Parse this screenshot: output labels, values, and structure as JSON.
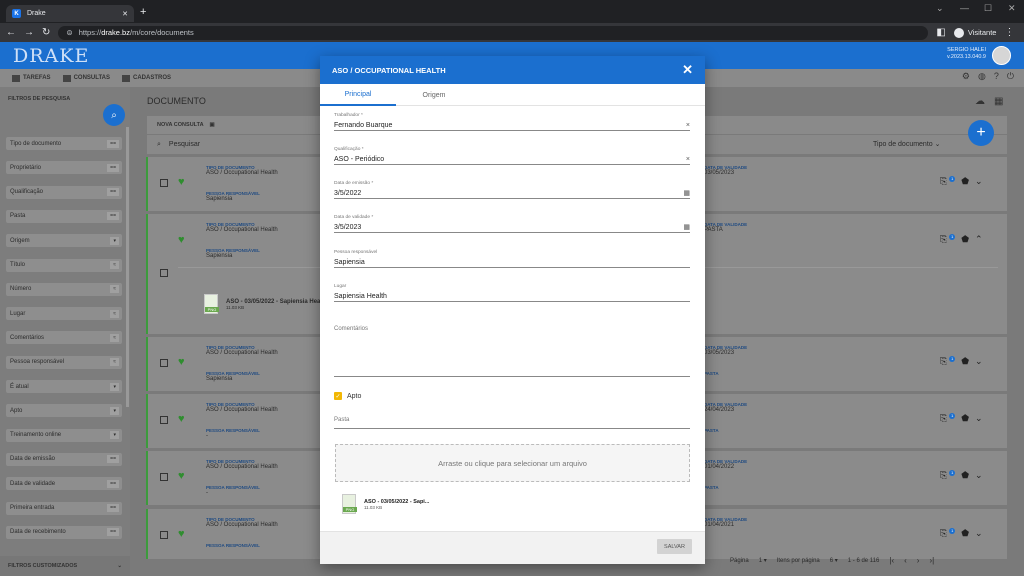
{
  "browser": {
    "tab_title": "Drake",
    "url_prefix": "https://",
    "url_host": "drake.bz",
    "url_path": "/m/core/documents",
    "profile": "Visitante"
  },
  "app": {
    "logo": "DRAKE",
    "user_name": "SERGIO HALEI",
    "user_version": "v.2023.13.040.9",
    "accent": "#1b6fcf"
  },
  "nav": {
    "items": [
      "TAREFAS",
      "CONSULTAS",
      "CADASTROS"
    ]
  },
  "sidebar": {
    "title": "FILTROS DE PESQUISA",
    "footer": "FILTROS CUSTOMIZADOS",
    "filters": [
      {
        "label": "Tipo de documento",
        "op": "=="
      },
      {
        "label": "Proprietário",
        "op": "=="
      },
      {
        "label": "Qualificação",
        "op": "=="
      },
      {
        "label": "Pasta",
        "op": "=="
      },
      {
        "label": "Origem",
        "op": "▾"
      },
      {
        "label": "Título",
        "op": "≈"
      },
      {
        "label": "Número",
        "op": "≈"
      },
      {
        "label": "Lugar",
        "op": "≈"
      },
      {
        "label": "Comentários",
        "op": "≈"
      },
      {
        "label": "Pessoa responsável",
        "op": "≈"
      },
      {
        "label": "É atual",
        "op": "▾"
      },
      {
        "label": "Apto",
        "op": "▾"
      },
      {
        "label": "Treinamento online",
        "op": "▾"
      },
      {
        "label": "Data de emissão",
        "op": "=="
      },
      {
        "label": "Data de validade",
        "op": "=="
      },
      {
        "label": "Primeira entrada",
        "op": "=="
      },
      {
        "label": "Data de recebimento",
        "op": "=="
      }
    ]
  },
  "main": {
    "title": "DOCUMENTO",
    "query_label": "NOVA CONSULTA",
    "search_placeholder": "Pesquisar",
    "sort_label": "Tipo de documento",
    "cards": [
      {
        "type_label": "TIPO DE DOCUMENTO",
        "type": "ASO / Occupational Health",
        "resp_label": "PESSOA RESPONSÁVEL",
        "resp": "Sapiensia",
        "val_label": "DATA DE VALIDADE",
        "val": "03/05/2023",
        "badge": "1"
      },
      {
        "type_label": "TIPO DE DOCUMENTO",
        "type": "ASO / Occupational Health",
        "resp_label": "PESSOA RESPONSÁVEL",
        "resp": "Sapiensia",
        "val_label": "DATA DE VALIDADE",
        "val": "PASTA",
        "badge": "1",
        "file": "ASO - 03/05/2022 - Sapiensia Heal",
        "file_size": "11.03 KB"
      },
      {
        "type_label": "TIPO DE DOCUMENTO",
        "type": "ASO / Occupational Health",
        "resp_label": "PESSOA RESPONSÁVEL",
        "resp": "Sapiensia",
        "val_label": "DATA DE VALIDADE",
        "val": "03/05/2023",
        "extra": "PASTA",
        "badge": "1"
      },
      {
        "type_label": "TIPO DE DOCUMENTO",
        "type": "ASO / Occupational Health",
        "resp_label": "PESSOA RESPONSÁVEL",
        "resp": "-",
        "val_label": "DATA DE VALIDADE",
        "val": "24/04/2023",
        "extra": "PASTA",
        "badge": "1"
      },
      {
        "type_label": "TIPO DE DOCUMENTO",
        "type": "ASO / Occupational Health",
        "resp_label": "PESSOA RESPONSÁVEL",
        "resp": "-",
        "val_label": "DATA DE VALIDADE",
        "val": "01/04/2022",
        "extra": "PASTA",
        "badge": "1"
      },
      {
        "type_label": "TIPO DE DOCUMENTO",
        "type": "ASO / Occupational Health",
        "resp_label": "PESSOA RESPONSÁVEL",
        "resp": "",
        "val_label": "DATA DE VALIDADE",
        "val": "01/04/2021",
        "badge": "1"
      }
    ],
    "pager": {
      "page_label": "Página",
      "page": "1",
      "per_page_label": "Itens por página",
      "per_page": "6",
      "range": "1 - 6 de 116"
    }
  },
  "modal": {
    "title": "ASO / OCCUPATIONAL HEALTH",
    "tabs": [
      "Principal",
      "Origem"
    ],
    "fields": [
      {
        "label": "Trabalhador *",
        "value": "Fernando Buarque",
        "icon": "×"
      },
      {
        "label": "Qualificação *",
        "value": "ASO - Periódico",
        "icon": "×"
      },
      {
        "label": "Data de emissão *",
        "value": "3/5/2022",
        "icon": "▦"
      },
      {
        "label": "Data de validade *",
        "value": "3/5/2023",
        "icon": "▦"
      },
      {
        "label": "Pessoa responsável",
        "value": "Sapiensia",
        "icon": ""
      },
      {
        "label": "Lugar",
        "value": "Sapiensia Health",
        "icon": ""
      }
    ],
    "comment_label": "Comentários",
    "apto_label": "Apto",
    "pasta_label": "Pasta",
    "drop_text": "Arraste ou clique para selecionar um arquivo",
    "file_name": "ASO - 03/05/2022 - Sapi...",
    "file_size": "11.03 KB",
    "file_ext": "PNG",
    "save": "SALVAR"
  }
}
